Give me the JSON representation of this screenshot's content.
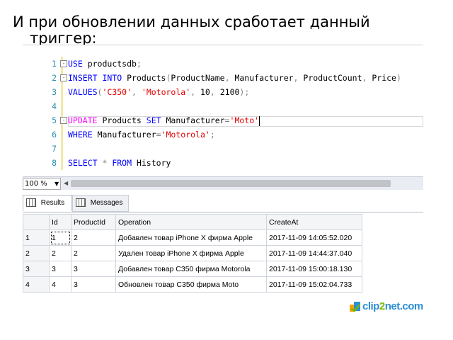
{
  "slide": {
    "title_line1": "И при обновлении данных сработает данный",
    "title_line2": "триггер:"
  },
  "editor": {
    "lines": [
      {
        "num": "1",
        "fold": "-",
        "tokens": [
          {
            "t": "USE",
            "c": "kw"
          },
          {
            "t": " productsdb",
            "c": ""
          },
          {
            "t": ";",
            "c": "gr"
          }
        ]
      },
      {
        "num": "2",
        "fold": "-",
        "tokens": [
          {
            "t": "INSERT INTO",
            "c": "kw"
          },
          {
            "t": " Products",
            "c": ""
          },
          {
            "t": "(",
            "c": "gr"
          },
          {
            "t": "ProductName",
            "c": ""
          },
          {
            "t": ", ",
            "c": "gr"
          },
          {
            "t": "Manufacturer",
            "c": ""
          },
          {
            "t": ", ",
            "c": "gr"
          },
          {
            "t": "ProductCount",
            "c": ""
          },
          {
            "t": ", ",
            "c": "gr"
          },
          {
            "t": "Price",
            "c": ""
          },
          {
            "t": ")",
            "c": "gr"
          }
        ]
      },
      {
        "num": "3",
        "fold": "",
        "tokens": [
          {
            "t": "VALUES",
            "c": "kw"
          },
          {
            "t": "(",
            "c": "gr"
          },
          {
            "t": "'C350'",
            "c": "str"
          },
          {
            "t": ", ",
            "c": "gr"
          },
          {
            "t": "'Motorola'",
            "c": "str"
          },
          {
            "t": ", ",
            "c": "gr"
          },
          {
            "t": "10",
            "c": ""
          },
          {
            "t": ", ",
            "c": "gr"
          },
          {
            "t": "2100",
            "c": ""
          },
          {
            "t": ");",
            "c": "gr"
          }
        ]
      },
      {
        "num": "4",
        "fold": "",
        "tokens": []
      },
      {
        "num": "5",
        "fold": "-",
        "tokens": [
          {
            "t": "UPDATE",
            "c": "pk"
          },
          {
            "t": " Products ",
            "c": ""
          },
          {
            "t": "SET",
            "c": "kw"
          },
          {
            "t": " Manufacturer",
            "c": ""
          },
          {
            "t": "=",
            "c": "gr"
          },
          {
            "t": "'Moto'",
            "c": "str"
          }
        ]
      },
      {
        "num": "6",
        "fold": "",
        "tokens": [
          {
            "t": "WHERE",
            "c": "kw"
          },
          {
            "t": " Manufacturer",
            "c": ""
          },
          {
            "t": "=",
            "c": "gr"
          },
          {
            "t": "'Motorola'",
            "c": "str"
          },
          {
            "t": ";",
            "c": "gr"
          }
        ]
      },
      {
        "num": "7",
        "fold": "",
        "tokens": []
      },
      {
        "num": "8",
        "fold": "",
        "tokens": [
          {
            "t": "SELECT",
            "c": "kw"
          },
          {
            "t": " * ",
            "c": "gr"
          },
          {
            "t": "FROM",
            "c": "kw"
          },
          {
            "t": " History",
            "c": ""
          }
        ]
      }
    ]
  },
  "statusbar": {
    "zoom": "100 %"
  },
  "results_tabs": {
    "results_label": "Results",
    "messages_label": "Messages"
  },
  "grid": {
    "columns": [
      "",
      "Id",
      "ProductId",
      "Operation",
      "CreateAt"
    ],
    "rows": [
      [
        "1",
        "1",
        "2",
        "Добавлен товар iPhone X   фирма Apple",
        "2017-11-09 14:05:52.020"
      ],
      [
        "2",
        "2",
        "2",
        "Удален товар iPhone X   фирма Apple",
        "2017-11-09 14:44:37.040"
      ],
      [
        "3",
        "3",
        "3",
        "Добавлен товар C350   фирма Motorola",
        "2017-11-09 15:00:18.130"
      ],
      [
        "4",
        "4",
        "3",
        "Обновлен товар C350   фирма Moto",
        "2017-11-09 15:02:04.733"
      ]
    ]
  },
  "watermark": {
    "text_a": "clip",
    "text_b": "2",
    "text_c": "net.com"
  }
}
